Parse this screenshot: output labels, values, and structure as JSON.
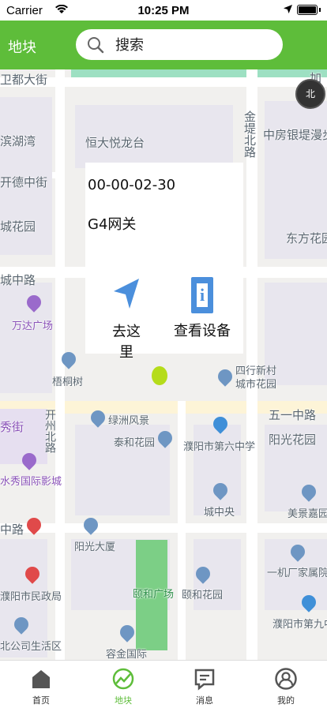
{
  "status": {
    "carrier": "Carrier",
    "time": "10:25 PM"
  },
  "header": {
    "title": "地块",
    "search_placeholder": "搜索"
  },
  "map": {
    "labels": {
      "weidu": "卫都大街",
      "binhu": "滨湖湾",
      "hengda": "恒大悦龙台",
      "jindi": "金堤北路",
      "zhongfang": "中房银堤漫步",
      "kaide": "开德中街",
      "chengyuan": "城花园",
      "dongfang": "东方花园",
      "chengzhonglu": "城中路",
      "wanda": "万达广场",
      "wutong": "梧桐树",
      "sihang": "四行新村\n城市花园",
      "wuyi": "五一中路",
      "lvzhou": "绿洲风景",
      "taihe": "泰和花园",
      "puyang6": "濮阳市第六中学",
      "yangguang_hy": "阳光花园",
      "xiujie": "秀街",
      "kaizhou": "开州北路",
      "shuixiu": "水秀国际影城",
      "chengzhongyang": "城中央",
      "meijing": "美景嘉园",
      "zhonglu": "中路",
      "yangguang_ds": "阳光大厦",
      "yihe_gc": "颐和广场",
      "yihe_hy": "颐和花园",
      "yijichang": "一机厂家属院",
      "zhengfu": "濮阳市民政局",
      "puyang9": "濮阳市第九中",
      "gongsi": "北公司生活区",
      "rongjin": "容金国际",
      "jia": "加"
    },
    "compass_label": "北"
  },
  "popup": {
    "device_id": "00-00-02-30",
    "device_name": "G4网关",
    "go_label": "去这里",
    "view_label": "查看设备",
    "device_icon_letter": "i"
  },
  "tabs": [
    {
      "label": "首页",
      "active": false
    },
    {
      "label": "地块",
      "active": true
    },
    {
      "label": "消息",
      "active": false
    },
    {
      "label": "我的",
      "active": false
    }
  ],
  "colors": {
    "brand": "#5ebd3a",
    "accent_blue": "#4b8fdc",
    "marker": "#b5dc1a"
  }
}
